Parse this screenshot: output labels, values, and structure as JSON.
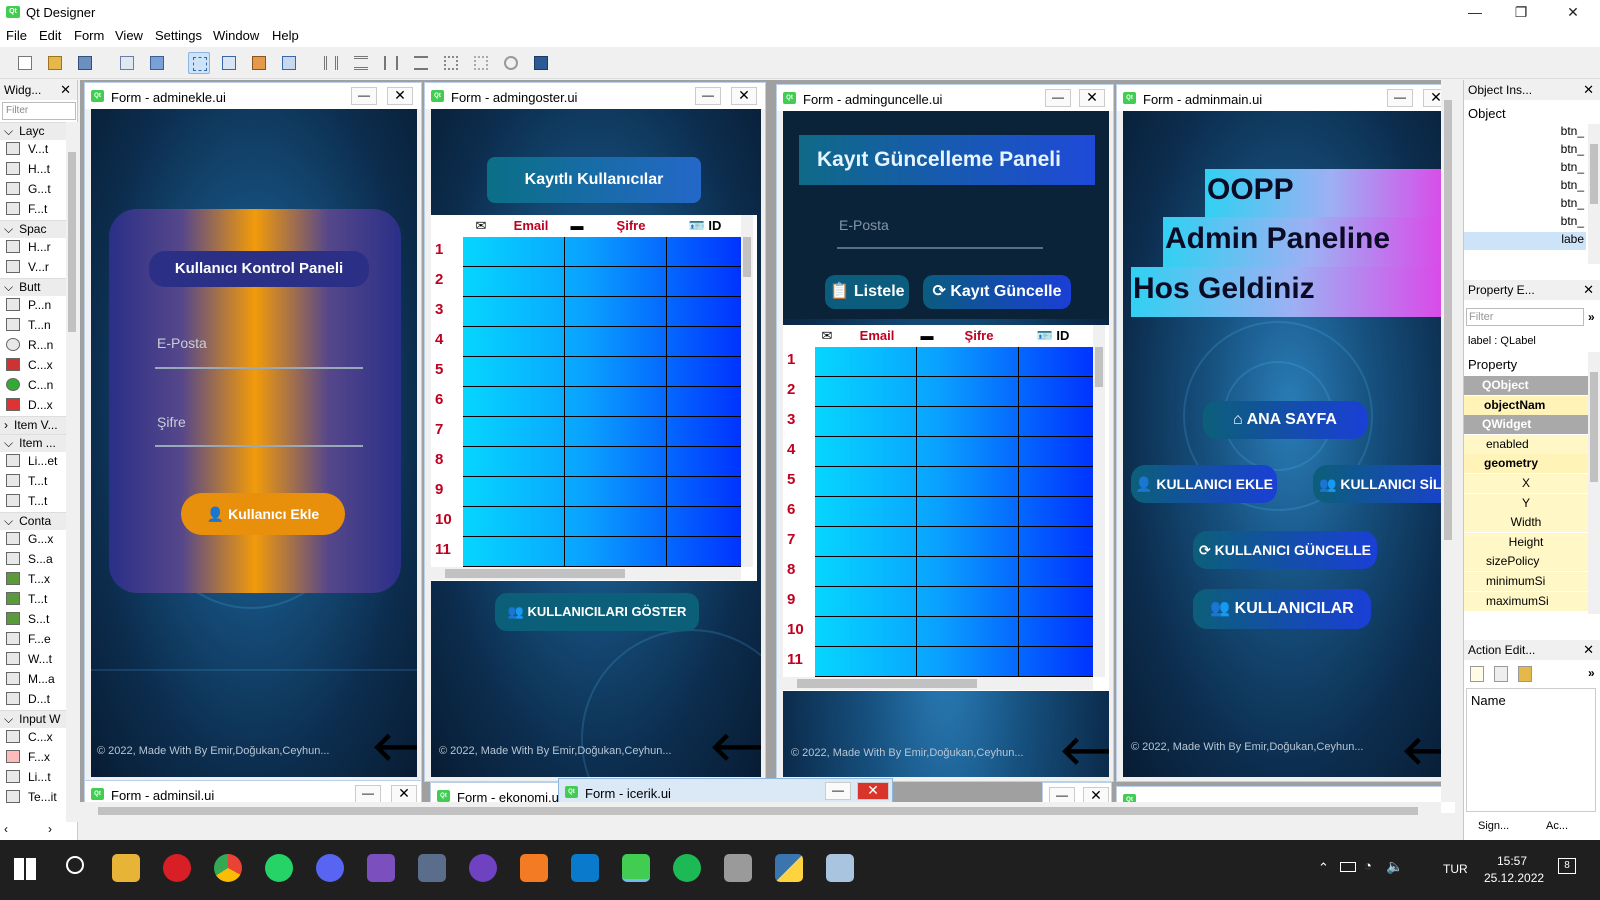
{
  "app": {
    "title": "Qt Designer",
    "icon": "qt-logo-icon"
  },
  "window_controls": {
    "minimize": "—",
    "maximize": "❐",
    "close": "✕"
  },
  "menu": [
    "File",
    "Edit",
    "Form",
    "View",
    "Settings",
    "Window",
    "Help"
  ],
  "widget_box": {
    "title": "Widg...",
    "filter_placeholder": "Filter",
    "categories": {
      "layouts": "Layc",
      "spacers": "Spac",
      "buttons": "Butt",
      "item_views": "Item V...",
      "item_widgets": "Item ...",
      "containers": "Conta",
      "input_widgets": "Input W"
    },
    "layout_items": [
      "V...t",
      "H...t",
      "G...t",
      "F...t"
    ],
    "spacer_items": [
      "H...r",
      "V...r"
    ],
    "button_items": [
      "P...n",
      "T...n",
      "R...n",
      "C...x",
      "C...n",
      "D...x"
    ],
    "item_widget_items": [
      "Li...et",
      "T...t",
      "T...t"
    ],
    "container_items": [
      "G...x",
      "S...a",
      "T...x",
      "T...t",
      "S...t",
      "F...e",
      "W...t",
      "M...a",
      "D...t"
    ],
    "input_items": [
      "C...x",
      "F...x",
      "Li...t",
      "Te...it"
    ]
  },
  "forms": {
    "adminekle": {
      "title": "Form - adminekle.ui",
      "panel_title": "Kullanıcı Kontrol Paneli",
      "email_placeholder": "E-Posta",
      "password_placeholder": "Şifre",
      "add_button": "Kullanıcı Ekle",
      "footer": "© 2022, Made With By Emir,Doğukan,Ceyhun...",
      "back_arrow": "🡐"
    },
    "admingoster": {
      "title": "Form - admingoster.ui",
      "heading": "Kayıtlı Kullanıcılar",
      "columns": [
        "Email",
        "Şifre",
        "ID"
      ],
      "rows": [
        "1",
        "2",
        "3",
        "4",
        "5",
        "6",
        "7",
        "8",
        "9",
        "10",
        "11"
      ],
      "show_button": "KULLANICILARI GÖSTER",
      "footer": "© 2022, Made With By Emir,Doğukan,Ceyhun...",
      "back_arrow": "🡐"
    },
    "adminguncelle": {
      "title": "Form - adminguncelle.ui",
      "heading": "Kayıt Güncelleme Paneli",
      "email_placeholder": "E-Posta",
      "list_button": "Listele",
      "update_button": "Kayıt Güncelle",
      "columns": [
        "Email",
        "Şifre",
        "ID"
      ],
      "rows": [
        "1",
        "2",
        "3",
        "4",
        "5",
        "6",
        "7",
        "8",
        "9",
        "10",
        "11"
      ],
      "footer": "© 2022, Made With By Emir,Doğukan,Ceyhun...",
      "back_arrow": "🡐"
    },
    "adminmain": {
      "title": "Form - adminmain.ui",
      "line1": "OOPP",
      "line2": "Admin Paneline",
      "line3": "Hos Geldiniz",
      "home_button": "ANA SAYFA",
      "add_user_button": "KULLANICI EKLE",
      "delete_user_button": "KULLANICI SİL",
      "update_user_button": "KULLANICI GÜNCELLE",
      "users_button": "KULLANICILAR",
      "footer": "© 2022, Made With By Emir,Doğukan,Ceyhun...",
      "back_arrow": "🡐"
    },
    "adminsil": {
      "title": "Form - adminsil.ui"
    },
    "ekonomi": {
      "title": "Form - ekonomi.ui"
    },
    "icerik": {
      "title": "Form - icerik.ui"
    }
  },
  "object_inspector": {
    "title": "Object Ins...",
    "column": "Object",
    "items": [
      "btn_",
      "btn_",
      "btn_",
      "btn_",
      "btn_",
      "btn_",
      "labe"
    ]
  },
  "property_editor": {
    "title": "Property E...",
    "filter_placeholder": "Filter",
    "context": "label : QLabel",
    "column": "Property",
    "rows": [
      {
        "name": "QObject",
        "kind": "group"
      },
      {
        "name": "objectNam",
        "kind": "bold"
      },
      {
        "name": "QWidget",
        "kind": "group"
      },
      {
        "name": "enabled",
        "kind": "plain"
      },
      {
        "name": "geometry",
        "kind": "bold"
      },
      {
        "name": "X",
        "kind": "sub"
      },
      {
        "name": "Y",
        "kind": "sub"
      },
      {
        "name": "Width",
        "kind": "sub"
      },
      {
        "name": "Height",
        "kind": "sub"
      },
      {
        "name": "sizePolicy",
        "kind": "plain"
      },
      {
        "name": "minimumSi",
        "kind": "plain"
      },
      {
        "name": "maximumSi",
        "kind": "plain"
      }
    ]
  },
  "action_editor": {
    "title": "Action Edit...",
    "column": "Name",
    "tabs": [
      "Sign...",
      "Ac..."
    ]
  },
  "taskbar": {
    "language": "TUR",
    "time": "15:57",
    "date": "25.12.2022",
    "notifications": "8"
  },
  "colors": {
    "accent_orange": "#e8900c",
    "table_cyan": "#06d6ff",
    "table_blue": "#0033ff",
    "magenta": "#e040e8",
    "header_red": "#c0001f"
  }
}
